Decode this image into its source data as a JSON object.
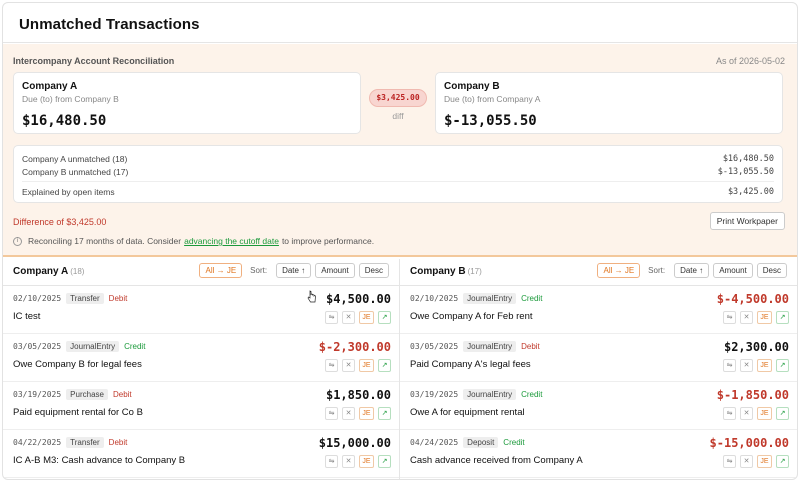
{
  "page": {
    "title": "Unmatched Transactions"
  },
  "reconciliation": {
    "title": "Intercompany Account Reconciliation",
    "as_of": "As of 2026-05-02",
    "company_a": {
      "name": "Company A",
      "subtitle": "Due (to) from Company B",
      "amount": "$16,480.50"
    },
    "company_b": {
      "name": "Company B",
      "subtitle": "Due (to) from Company A",
      "amount": "$-13,055.50"
    },
    "difference_pill": "$3,425.00",
    "difference_label": "diff",
    "summary": [
      {
        "label": "Company A unmatched (18)",
        "value": "$16,480.50"
      },
      {
        "label": "Company B unmatched (17)",
        "value": "$-13,055.50"
      },
      {
        "label": "Explained by open items",
        "value": "$3,425.00"
      }
    ],
    "difference_text": "Difference of $3,425.00",
    "print_button": "Print Workpaper",
    "info": {
      "prefix": "Reconciling 17 months of data. Consider",
      "link": "advancing the cutoff date",
      "suffix": "to improve performance."
    }
  },
  "columns": {
    "a": {
      "title": "Company A",
      "count": "(18)",
      "je_button": "All → JE",
      "sort_label": "Sort:",
      "sort_date": "Date ↑",
      "sort_amount": "Amount",
      "sort_desc": "Desc",
      "rows": [
        {
          "date": "02/10/2025",
          "type": "Transfer",
          "direction": "Debit",
          "amount": "$4,500.00",
          "description": "IC test"
        },
        {
          "date": "03/05/2025",
          "type": "JournalEntry",
          "direction": "Credit",
          "amount": "$-2,300.00",
          "description": "Owe Company B for legal fees"
        },
        {
          "date": "03/19/2025",
          "type": "Purchase",
          "direction": "Debit",
          "amount": "$1,850.00",
          "description": "Paid equipment rental for Co B"
        },
        {
          "date": "04/22/2025",
          "type": "Transfer",
          "direction": "Debit",
          "amount": "$15,000.00",
          "description": "IC A-B M3: Cash advance to Company B"
        }
      ]
    },
    "b": {
      "title": "Company B",
      "count": "(17)",
      "je_button": "All → JE",
      "sort_label": "Sort:",
      "sort_date": "Date ↑",
      "sort_amount": "Amount",
      "sort_desc": "Desc",
      "rows": [
        {
          "date": "02/10/2025",
          "type": "JournalEntry",
          "direction": "Credit",
          "amount": "$-4,500.00",
          "description": "Owe Company A for Feb rent"
        },
        {
          "date": "03/05/2025",
          "type": "JournalEntry",
          "direction": "Debit",
          "amount": "$2,300.00",
          "description": "Paid Company A's legal fees"
        },
        {
          "date": "03/19/2025",
          "type": "JournalEntry",
          "direction": "Credit",
          "amount": "$-1,850.00",
          "description": "Owe A for equipment rental"
        },
        {
          "date": "04/24/2025",
          "type": "Deposit",
          "direction": "Credit",
          "amount": "$-15,000.00",
          "description": "Cash advance received from Company A"
        }
      ]
    }
  },
  "row_actions": {
    "je_label": "JE"
  },
  "colors": {
    "debit": "#c0392b",
    "credit": "#1b9a3b",
    "accent": "#e0741e",
    "panel_bg": "#fdf3ea"
  }
}
